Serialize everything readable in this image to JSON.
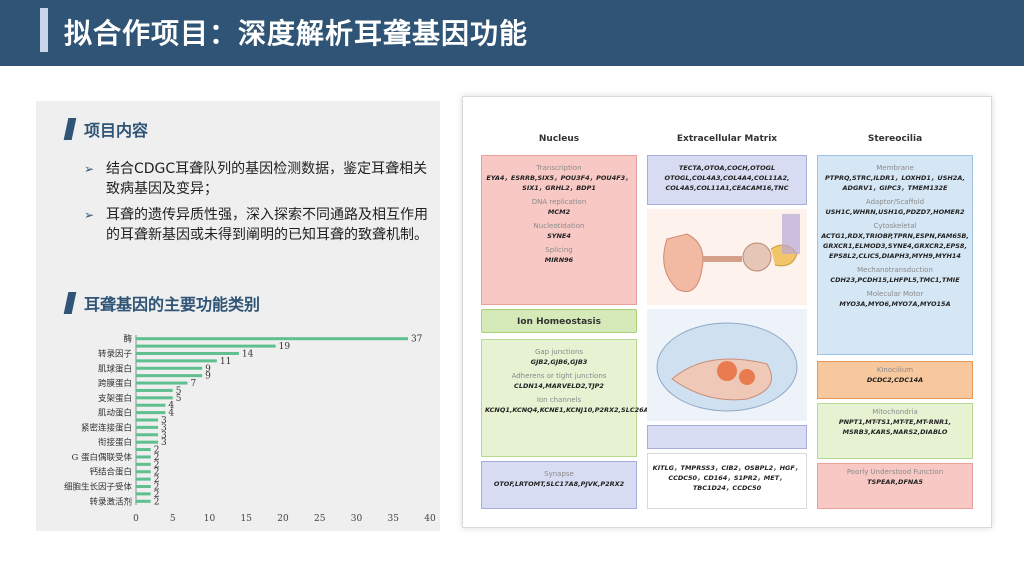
{
  "header": {
    "title": "拟合作项目：深度解析耳聋基因功能"
  },
  "section1": {
    "title": "项目内容",
    "bullets": [
      "结合CDGC耳聋队列的基因检测数据，鉴定耳聋相关致病基因及变异；",
      "耳聋的遗传异质性强，深入探索不同通路及相互作用的耳聋新基因或未得到阐明的已知耳聋的致聋机制。"
    ]
  },
  "section2": {
    "title": "耳聋基因的主要功能类别"
  },
  "chart_data": {
    "type": "bar",
    "orientation": "horizontal",
    "categories": [
      "酶",
      "",
      "转录因子",
      "",
      "肌球蛋白",
      "",
      "跨膜蛋白",
      "",
      "支架蛋白",
      "",
      "肌动蛋白",
      "",
      "紧密连接蛋白",
      "",
      "衔接蛋白",
      "",
      "G蛋白偶联受体",
      "",
      "钙结合蛋白",
      "",
      "细胞生长因子受体",
      "",
      "转录激活剂"
    ],
    "tick_labels": [
      "酶",
      "转录因子",
      "肌球蛋白",
      "跨膜蛋白",
      "支架蛋白",
      "肌动蛋白",
      "紧密连接蛋白",
      "衔接蛋白",
      "G 蛋白偶联受体",
      "钙结合蛋白",
      "细胞生长因子受体",
      "转录激活剂"
    ],
    "values": [
      37,
      19,
      14,
      11,
      9,
      9,
      7,
      5,
      5,
      4,
      4,
      3,
      3,
      3,
      3,
      2,
      2,
      2,
      2,
      2,
      2,
      2,
      2
    ],
    "xlim": [
      0,
      40
    ],
    "xticks": [
      0,
      5,
      10,
      15,
      20,
      25,
      30,
      35,
      40
    ],
    "bar_color": "#5fbf8f"
  },
  "diagram": {
    "columns": [
      {
        "title": "Nucleus",
        "color": "#f4a6a0"
      },
      {
        "title": "Extracellular Matrix",
        "color": "#d9d9d9"
      },
      {
        "title": "Stereocilia",
        "color": "#9ec3e6"
      }
    ],
    "nucleus": {
      "groups": [
        {
          "label": "Transcription",
          "genes": "EYA4，ESRRB,SIX5，POU3F4，POU4F3，SIX1，GRHL2，BDP1"
        },
        {
          "label": "DNA replication",
          "genes": "MCM2"
        },
        {
          "label": "Nucleotidation",
          "genes": "SYNE4"
        },
        {
          "label": "Splicing",
          "genes": "MIRN96"
        }
      ]
    },
    "ion": {
      "title": "Ion Homeostasis",
      "groups": [
        {
          "label": "Gap junctions",
          "genes": "GJB2,GJB6,GJB3"
        },
        {
          "label": "Adherens or tight junctions",
          "genes": "CLDN14,MARVELD2,TJP2"
        },
        {
          "label": "Ion channels",
          "genes": "KCNQ1,KCNQ4,KCNE1,KCNJ10,P2RX2,SLC26A5,SLC26A4,WFS1"
        }
      ]
    },
    "synapse": {
      "title": "Synapse",
      "genes": "OTOF,LRTOMT,SLC17A8,PJVK,P2RX2"
    },
    "ecm": {
      "genes": "TECTA,OTOA,COCH,OTOGL OTOGL,COL4A3,COL4A4,COL11A2, COL4A5,COL11A1,CEACAM16,TNC"
    },
    "misc": {
      "genes": "KITLG，TMPRSS3，CIB2，OSBPL2，HGF，CCDC50，CD164，S1PR2，MET，TBC1D24，CCDC50"
    },
    "stereocilia": {
      "groups": [
        {
          "label": "Membrane",
          "genes": "PTPRQ,STRC,ILDR1，LOXHD1，USH2A, ADGRV1，GIPC3，TMEM132E"
        },
        {
          "label": "Adaptor/Scaffold",
          "genes": "USH1C,WHRN,USH1G,PDZD7,HOMER2"
        },
        {
          "label": "Cytoskeletal",
          "genes": "ACTG1,RDX,TRIOBP,TPRN,ESPN,FAM65B, GRXCR1,ELMOD3,SYNE4,GRXCR2,EPS8, EPS8L2,CLIC5,DIAPH3,MYH9,MYH14"
        },
        {
          "label": "Mechanotransduction",
          "genes": "CDH23,PCDH15,LHFPL5,TMC1,TMIE"
        },
        {
          "label": "Molecular Motor",
          "genes": "MYO3A,MYO6,MYO7A,MYO15A"
        }
      ]
    },
    "kinocilium": {
      "title": "Kinocilium",
      "genes": "DCDC2,CDC14A"
    },
    "mitochondria": {
      "title": "Mitochondria",
      "genes": "PNPT1,MT-TS1,MT-TE,MT-RNR1, MSRB3,KARS,NARS2,DIABLO"
    },
    "poorly": {
      "title": "Poorly Understood Function",
      "genes": "TSPEAR,DFNA5"
    }
  }
}
